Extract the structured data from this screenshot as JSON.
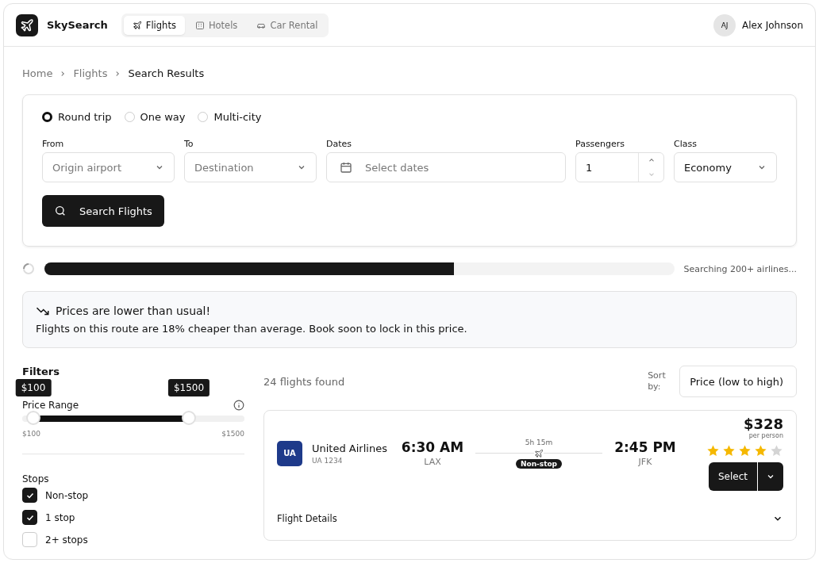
{
  "brand": {
    "name": "SkySearch"
  },
  "nav_tabs": [
    {
      "label": "Flights",
      "selected": true
    },
    {
      "label": "Hotels",
      "selected": false
    },
    {
      "label": "Car Rental",
      "selected": false
    }
  ],
  "user": {
    "initials": "AJ",
    "name": "Alex Johnson"
  },
  "breadcrumb": [
    {
      "label": "Home",
      "current": false
    },
    {
      "label": "Flights",
      "current": false
    },
    {
      "label": "Search Results",
      "current": true
    }
  ],
  "trip_types": [
    {
      "label": "Round trip",
      "selected": true
    },
    {
      "label": "One way",
      "selected": false
    },
    {
      "label": "Multi-city",
      "selected": false
    }
  ],
  "fields": {
    "from": {
      "label": "From",
      "placeholder": "Origin airport"
    },
    "to": {
      "label": "To",
      "placeholder": "Destination"
    },
    "dates": {
      "label": "Dates",
      "placeholder": "Select dates"
    },
    "passengers": {
      "label": "Passengers",
      "value": "1"
    },
    "class": {
      "label": "Class",
      "value": "Economy"
    }
  },
  "search_button": "Search Flights",
  "progress": {
    "level": 0.65,
    "status": "Searching 200+ airlines..."
  },
  "alert": {
    "title": "Prices are lower than usual!",
    "message": "Flights on this route are 18% cheaper than average. Book soon to lock in this price."
  },
  "filters": {
    "title": "Filters",
    "price_range": {
      "label": "Price Range",
      "thumbs": [
        {
          "level": 0.05,
          "tooltip": "$100"
        },
        {
          "level": 0.75,
          "tooltip": "$1500"
        }
      ],
      "min_label": "$100",
      "max_label": "$1500"
    },
    "stops": {
      "title": "Stops",
      "options": [
        {
          "label": "Non-stop",
          "checked": true
        },
        {
          "label": "1 stop",
          "checked": true
        },
        {
          "label": "2+ stops",
          "checked": false
        }
      ]
    }
  },
  "results": {
    "count": "24 flights found",
    "sort_label": "Sort by:",
    "sort_value": "Price (low to high)"
  },
  "flights": [
    {
      "airline_code": "UA",
      "airline": "United Airlines",
      "flight_number": "UA 1234",
      "depart_time": "6:30 AM",
      "depart_airport": "LAX",
      "duration": "5h 15m",
      "stops": "Non-stop",
      "arrive_time": "2:45 PM",
      "arrive_airport": "JFK",
      "price": "$328",
      "price_note": "per person",
      "stars": 4,
      "select": "Select",
      "details": "Flight Details"
    }
  ]
}
